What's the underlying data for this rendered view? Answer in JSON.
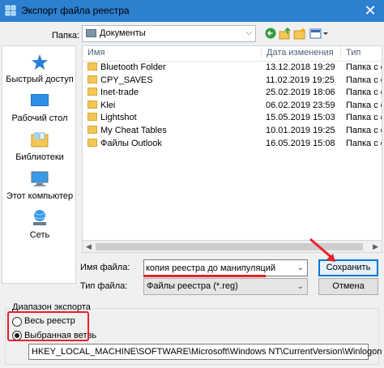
{
  "window": {
    "title": "Экспорт файла реестра",
    "close_glyph": "✕"
  },
  "folder": {
    "label": "Папка:",
    "value": "Документы"
  },
  "toolbar": {
    "back_icon": "back-icon",
    "up_icon": "up-folder-icon",
    "new_folder_icon": "new-folder-icon",
    "view_icon": "view-menu-icon"
  },
  "places": [
    {
      "label": "Быстрый доступ",
      "icon": "star-icon"
    },
    {
      "label": "Рабочий стол",
      "icon": "desktop-icon"
    },
    {
      "label": "Библиотеки",
      "icon": "libraries-icon"
    },
    {
      "label": "Этот компьютер",
      "icon": "computer-icon"
    },
    {
      "label": "Сеть",
      "icon": "network-icon"
    }
  ],
  "columns": [
    "Имя",
    "Дата изменения",
    "Тип"
  ],
  "files": [
    {
      "name": "Bluetooth Folder",
      "date": "13.12.2018 19:29",
      "type": "Папка с ф"
    },
    {
      "name": "CPY_SAVES",
      "date": "11.02.2019 19:25",
      "type": "Папка с ф"
    },
    {
      "name": "Inet-trade",
      "date": "25.02.2019 18:06",
      "type": "Папка с ф"
    },
    {
      "name": "Klei",
      "date": "06.02.2019 23:59",
      "type": "Папка с ф"
    },
    {
      "name": "Lightshot",
      "date": "15.05.2019 15:03",
      "type": "Папка с ф"
    },
    {
      "name": "My Cheat Tables",
      "date": "10.01.2019 19:25",
      "type": "Папка с ф"
    },
    {
      "name": "Файлы Outlook",
      "date": "16.05.2019 15:08",
      "type": "Папка с ф"
    }
  ],
  "filename": {
    "label": "Имя файла:",
    "value": "копия реестра до манипуляций"
  },
  "filetype": {
    "label": "Тип файла:",
    "value": "Файлы реестра (*.reg)"
  },
  "buttons": {
    "save": "Сохранить",
    "cancel": "Отмена"
  },
  "export_range": {
    "title": "Диапазон экспорта",
    "whole": "Весь реестр",
    "branch": "Выбранная ветвь",
    "selected": "branch",
    "path": "HKEY_LOCAL_MACHINE\\SOFTWARE\\Microsoft\\Windows NT\\CurrentVersion\\Winlogon"
  },
  "colors": {
    "titlebar": "#2d7fcf",
    "highlight": "#e8202a",
    "folder": "#f4c656"
  }
}
